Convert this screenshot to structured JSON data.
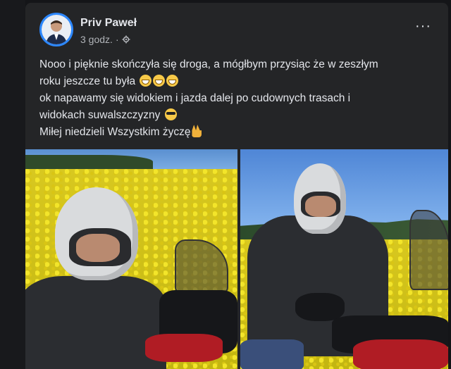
{
  "post": {
    "author": "Priv Paweł",
    "time": "3 godz.",
    "separator": "·",
    "privacy_icon": "gear-icon",
    "more_label": "···",
    "lines": {
      "l1": "Nooo i pięknie skończyła się droga, a mógłbym przysiąc że w zeszłym",
      "l2": "roku jeszcze tu była",
      "l3": "ok napawamy się widokiem i jazda dalej po cudownych trasach i",
      "l4": "widokach suwalszczyzny",
      "l5": "Miłej niedzieli Wszystkim życzę"
    }
  },
  "colors": {
    "background": "#141518",
    "card": "#242527",
    "text": "#e4e6eb",
    "muted": "#b0b3b8",
    "avatar_ring": "#2d88ff"
  }
}
